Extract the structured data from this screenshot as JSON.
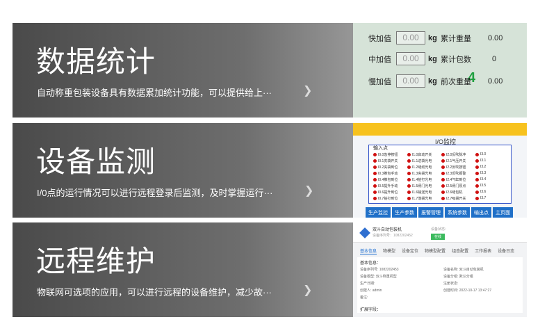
{
  "cards": [
    {
      "title": "数据统计",
      "desc": "自动称重包装设备具有数据累加统计功能，可以提供给上···",
      "arrow": "❯",
      "panel": {
        "rows": [
          {
            "label": "快加值",
            "value": "0.00",
            "unit": "kg",
            "key": "累计重量",
            "val": "0.00"
          },
          {
            "label": "中加值",
            "value": "0.00",
            "unit": "kg",
            "key": "累计包数",
            "val": "0"
          },
          {
            "label": "慢加值",
            "value": "0.00",
            "unit": "kg",
            "key": "前次重量",
            "val": "0.00"
          }
        ],
        "highlight": "4"
      }
    },
    {
      "title": "设备监测",
      "desc": "I/0点的运行情况可以进行远程登录后监测，及时掌握运行···",
      "arrow": "❯",
      "panel": {
        "title": "I/O监控",
        "input_label": "输入点",
        "io": [
          "I0.0急停按钮",
          "I1.0启动开关",
          "I2.0反吹脉冲",
          "I3.0",
          "I0.1夹袋开关",
          "I1.1进袋光电",
          "I2.1气压开关",
          "I3.1",
          "I0.2夹袋到位",
          "I1.2缝纫光电",
          "I2.2反吹按钮",
          "I3.2",
          "I0.3推包手动",
          "I1.3夹袋光电",
          "I2.3反吹报警",
          "I3.3",
          "I0.4推包到位",
          "I1.4拍打光电",
          "I2.4气缸到位",
          "I3.4",
          "I0.5提升手动",
          "I1.5闸门光电",
          "I2.5闸门原点",
          "I3.5",
          "I0.6提升到位",
          "I1.6输送光电",
          "I2.6缝包机",
          "I3.6",
          "I0.7拍打到位",
          "I1.7落袋光电",
          "I2.7吸袋开关",
          "I3.7"
        ],
        "tabs": [
          "生产监控",
          "生产参数",
          "报警管理",
          "系统参数",
          "输出点",
          "主页面"
        ]
      }
    },
    {
      "title": "远程维护",
      "desc": "物联网可选项的应用，可以进行远程的设备维护，减少故···",
      "arrow": "❯",
      "panel": {
        "device_name": "双斗自动包装机",
        "device_id": "设备序列号：1082202452",
        "status_label": "设备状态：",
        "status": "在线",
        "tabs": [
          "基本信息",
          "物模型",
          "设备定位",
          "物模型配置",
          "组态配置",
          "工作报表",
          "设备日志"
        ],
        "section_basic": "基本信息：",
        "fields": [
          "设备序列号: 1082202453",
          "设备名称: 双斗自动包装机",
          "设备模型: 双斗称重机型",
          "设备分组: 默认分组",
          "生产日期:",
          "注册状态:",
          "创建人: admin",
          "创建时间: 2022-10-17 13:47:27",
          "备注:"
        ],
        "section_ext": "扩展字段："
      }
    }
  ]
}
